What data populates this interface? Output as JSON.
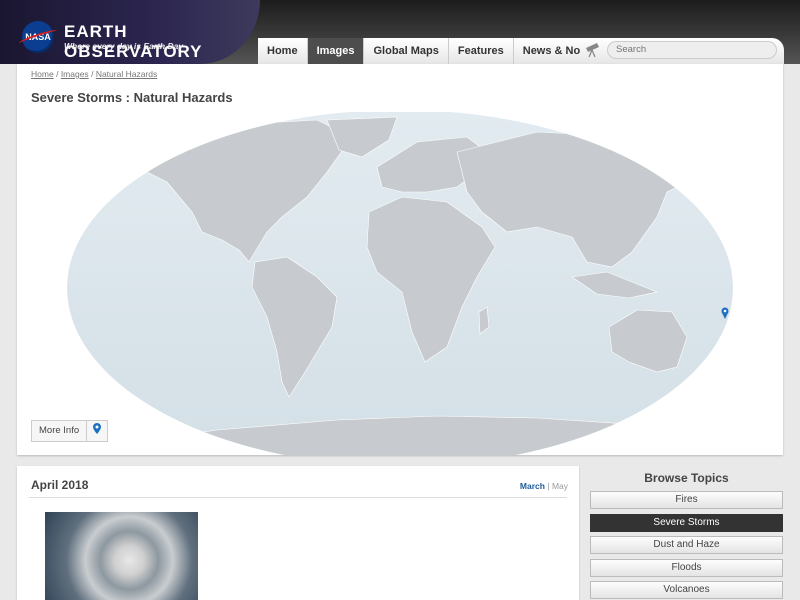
{
  "header": {
    "logo_text": "NASA",
    "title": "EARTH OBSERVATORY",
    "tagline": "Where every day is Earth Day",
    "nav": [
      {
        "label": "Home",
        "active": false
      },
      {
        "label": "Images",
        "active": true
      },
      {
        "label": "Global Maps",
        "active": false
      },
      {
        "label": "Features",
        "active": false
      },
      {
        "label": "News & Notes",
        "active": false
      }
    ],
    "search_placeholder": "Search",
    "telescope_icon": "telescope-icon"
  },
  "breadcrumb": {
    "items": [
      "Home",
      "Images",
      "Natural Hazards"
    ],
    "separator": "/"
  },
  "page_title": "Severe Storms : Natural Hazards",
  "map": {
    "more_info_label": "More Info",
    "pin_icon": "map-pin-icon",
    "marker_icon": "map-pin-icon"
  },
  "archive": {
    "month_title": "April 2018",
    "month_nav": {
      "prev": "March",
      "separator": "|",
      "next": "May"
    }
  },
  "browse": {
    "title": "Browse Topics",
    "items": [
      {
        "label": "Fires",
        "selected": false
      },
      {
        "label": "Severe Storms",
        "selected": true
      },
      {
        "label": "Dust and Haze",
        "selected": false
      },
      {
        "label": "Floods",
        "selected": false
      },
      {
        "label": "Volcanoes",
        "selected": false
      }
    ]
  },
  "colors": {
    "accent": "#1d6fbf",
    "nav_active": "#4d4d4d",
    "ocean": "#dbe6ec",
    "land": "#c8ccd0"
  }
}
